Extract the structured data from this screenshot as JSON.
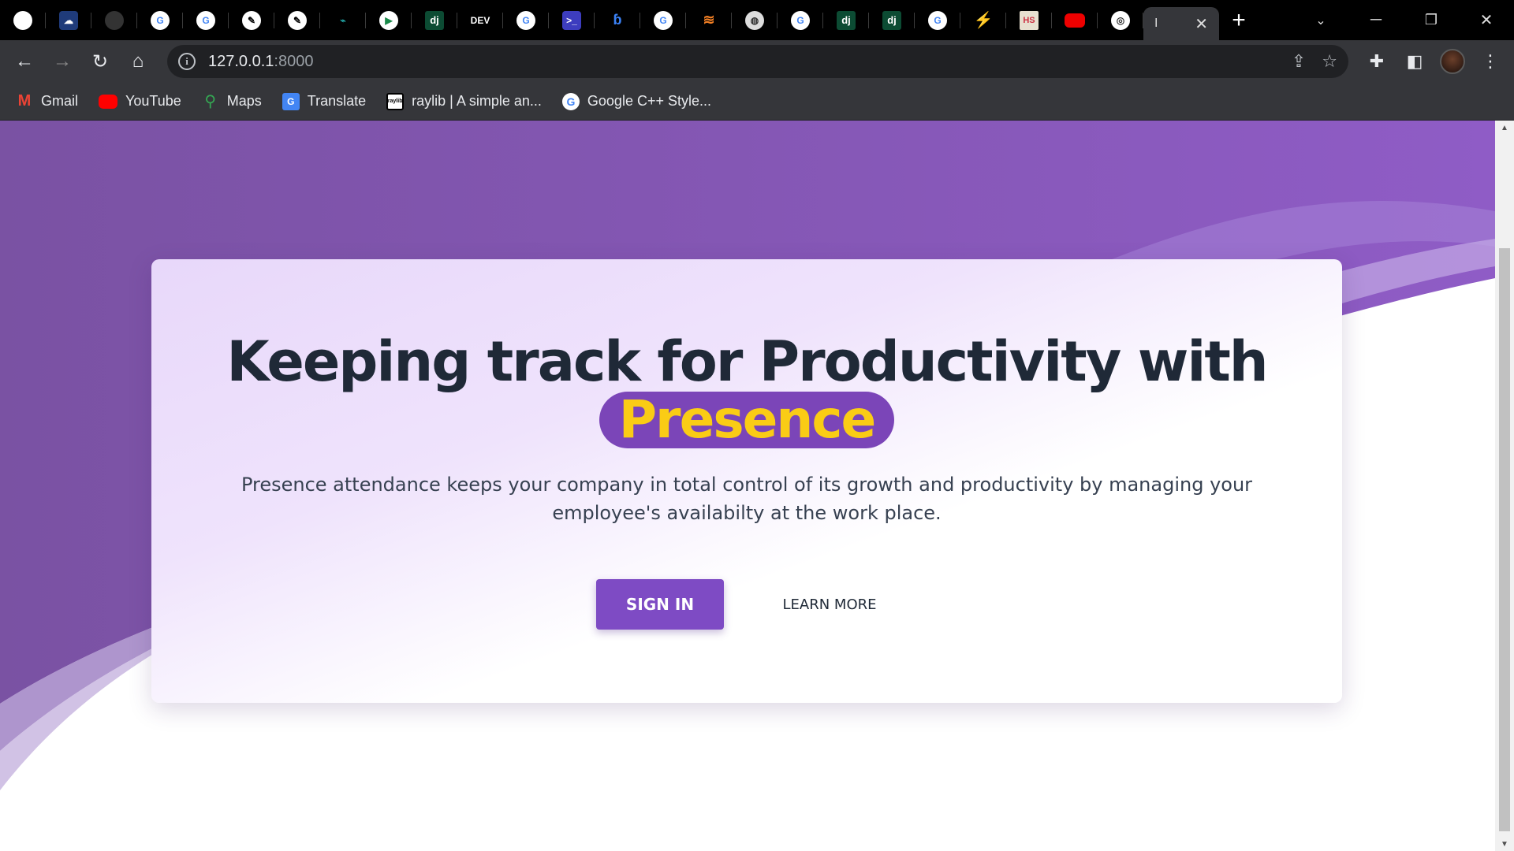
{
  "browser": {
    "tabs": [
      {
        "icon": "github-icon",
        "glyph": ""
      },
      {
        "icon": "cloud-app-icon",
        "glyph": "☁"
      },
      {
        "icon": "dark-circle-icon",
        "glyph": ""
      },
      {
        "icon": "google-icon",
        "glyph": "G"
      },
      {
        "icon": "google-icon",
        "glyph": "G"
      },
      {
        "icon": "feather-icon",
        "glyph": "✎"
      },
      {
        "icon": "feather-icon",
        "glyph": "✎"
      },
      {
        "icon": "teal-mark-icon",
        "glyph": "⌁"
      },
      {
        "icon": "play-icon",
        "glyph": "▶"
      },
      {
        "icon": "django-icon",
        "glyph": "dj"
      },
      {
        "icon": "dev-icon",
        "glyph": "DEV"
      },
      {
        "icon": "google-icon",
        "glyph": "G"
      },
      {
        "icon": "terminal-icon",
        "glyph": ">_"
      },
      {
        "icon": "blue-mark-icon",
        "glyph": "ɓ"
      },
      {
        "icon": "google-icon",
        "glyph": "G"
      },
      {
        "icon": "stackoverflow-icon",
        "glyph": "≋"
      },
      {
        "icon": "globe-icon",
        "glyph": "◍"
      },
      {
        "icon": "google-icon",
        "glyph": "G"
      },
      {
        "icon": "django-icon",
        "glyph": "dj"
      },
      {
        "icon": "django-icon",
        "glyph": "dj"
      },
      {
        "icon": "google-icon",
        "glyph": "G"
      },
      {
        "icon": "bolt-icon",
        "glyph": "⚡"
      },
      {
        "icon": "hs-icon",
        "glyph": "HS"
      },
      {
        "icon": "youtube-icon",
        "glyph": ""
      },
      {
        "icon": "chrome-icon",
        "glyph": "◎"
      }
    ],
    "active_tab_label": "I",
    "address": {
      "host": "127.0.0.1",
      "port": ":8000"
    },
    "bookmarks": [
      {
        "label": "Gmail",
        "icon": "gmail-icon",
        "glyph": "M"
      },
      {
        "label": "YouTube",
        "icon": "youtube-icon",
        "glyph": ""
      },
      {
        "label": "Maps",
        "icon": "maps-icon",
        "glyph": "⚲"
      },
      {
        "label": "Translate",
        "icon": "translate-icon",
        "glyph": "G"
      },
      {
        "label": "raylib | A simple an...",
        "icon": "raylib-icon",
        "glyph": "raylib"
      },
      {
        "label": "Google C++ Style...",
        "icon": "google-icon",
        "glyph": "G"
      }
    ]
  },
  "hero": {
    "headline": "Keeping track for Productivity with",
    "brand": "Presence",
    "subtitle": "Presence attendance keeps your company in total control of its growth and productivity by managing your employee's availabilty at the work place.",
    "primary_button": "SIGN IN",
    "secondary_button": "LEARN MORE"
  },
  "colors": {
    "brand_purple": "#7b45b8",
    "brand_yellow": "#facc15",
    "button_purple": "#7e4bc4",
    "heading_dark": "#1f2937"
  }
}
